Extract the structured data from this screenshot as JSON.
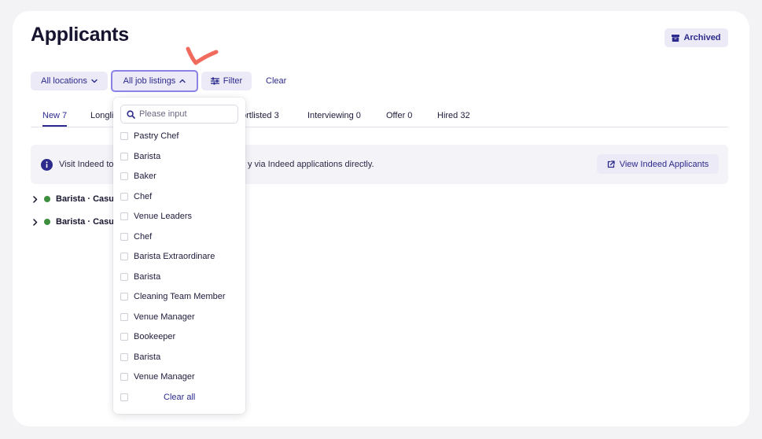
{
  "header": {
    "title": "Applicants",
    "archived_label": "Archived"
  },
  "filters": {
    "locations_label": "All locations",
    "listings_label": "All job listings",
    "filter_label": "Filter",
    "clear_label": "Clear"
  },
  "tabs": [
    {
      "label": "New 7",
      "active": true
    },
    {
      "label": "Longli",
      "active": false
    },
    {
      "label": "ortlisted 3",
      "active": false
    },
    {
      "label": "Interviewing 0",
      "active": false
    },
    {
      "label": "Offer 0",
      "active": false
    },
    {
      "label": "Hired 32",
      "active": false
    }
  ],
  "banner": {
    "text_left": "Visit Indeed to",
    "text_right": "y via Indeed applications directly.",
    "button_label": "View Indeed Applicants"
  },
  "rows": [
    {
      "label": "Barista · Casua"
    },
    {
      "label": "Barista · Casua"
    }
  ],
  "dropdown": {
    "search_placeholder": "Please input",
    "options": [
      "Pastry Chef",
      "Barista",
      "Baker",
      "Chef",
      "Venue Leaders",
      "Chef",
      "Barista Extraordinare",
      "Barista",
      "Cleaning Team Member",
      "Venue Manager",
      "Bookeeper",
      "Barista",
      "Venue Manager"
    ],
    "clear_all_label": "Clear all"
  },
  "colors": {
    "accent": "#2c2a8c",
    "pill_bg": "#eceaf6",
    "active_border": "#8b82e6",
    "status_dot": "#3e8e3e",
    "annotation_mark": "#f06a5e"
  },
  "icons": {
    "archived": "archive-box-icon",
    "locations": "chevron-down-icon",
    "listings": "chevron-up-icon",
    "filter": "sliders-icon",
    "info": "info-icon",
    "view": "external-link-icon",
    "search": "search-icon",
    "row": "chevron-right-icon"
  }
}
